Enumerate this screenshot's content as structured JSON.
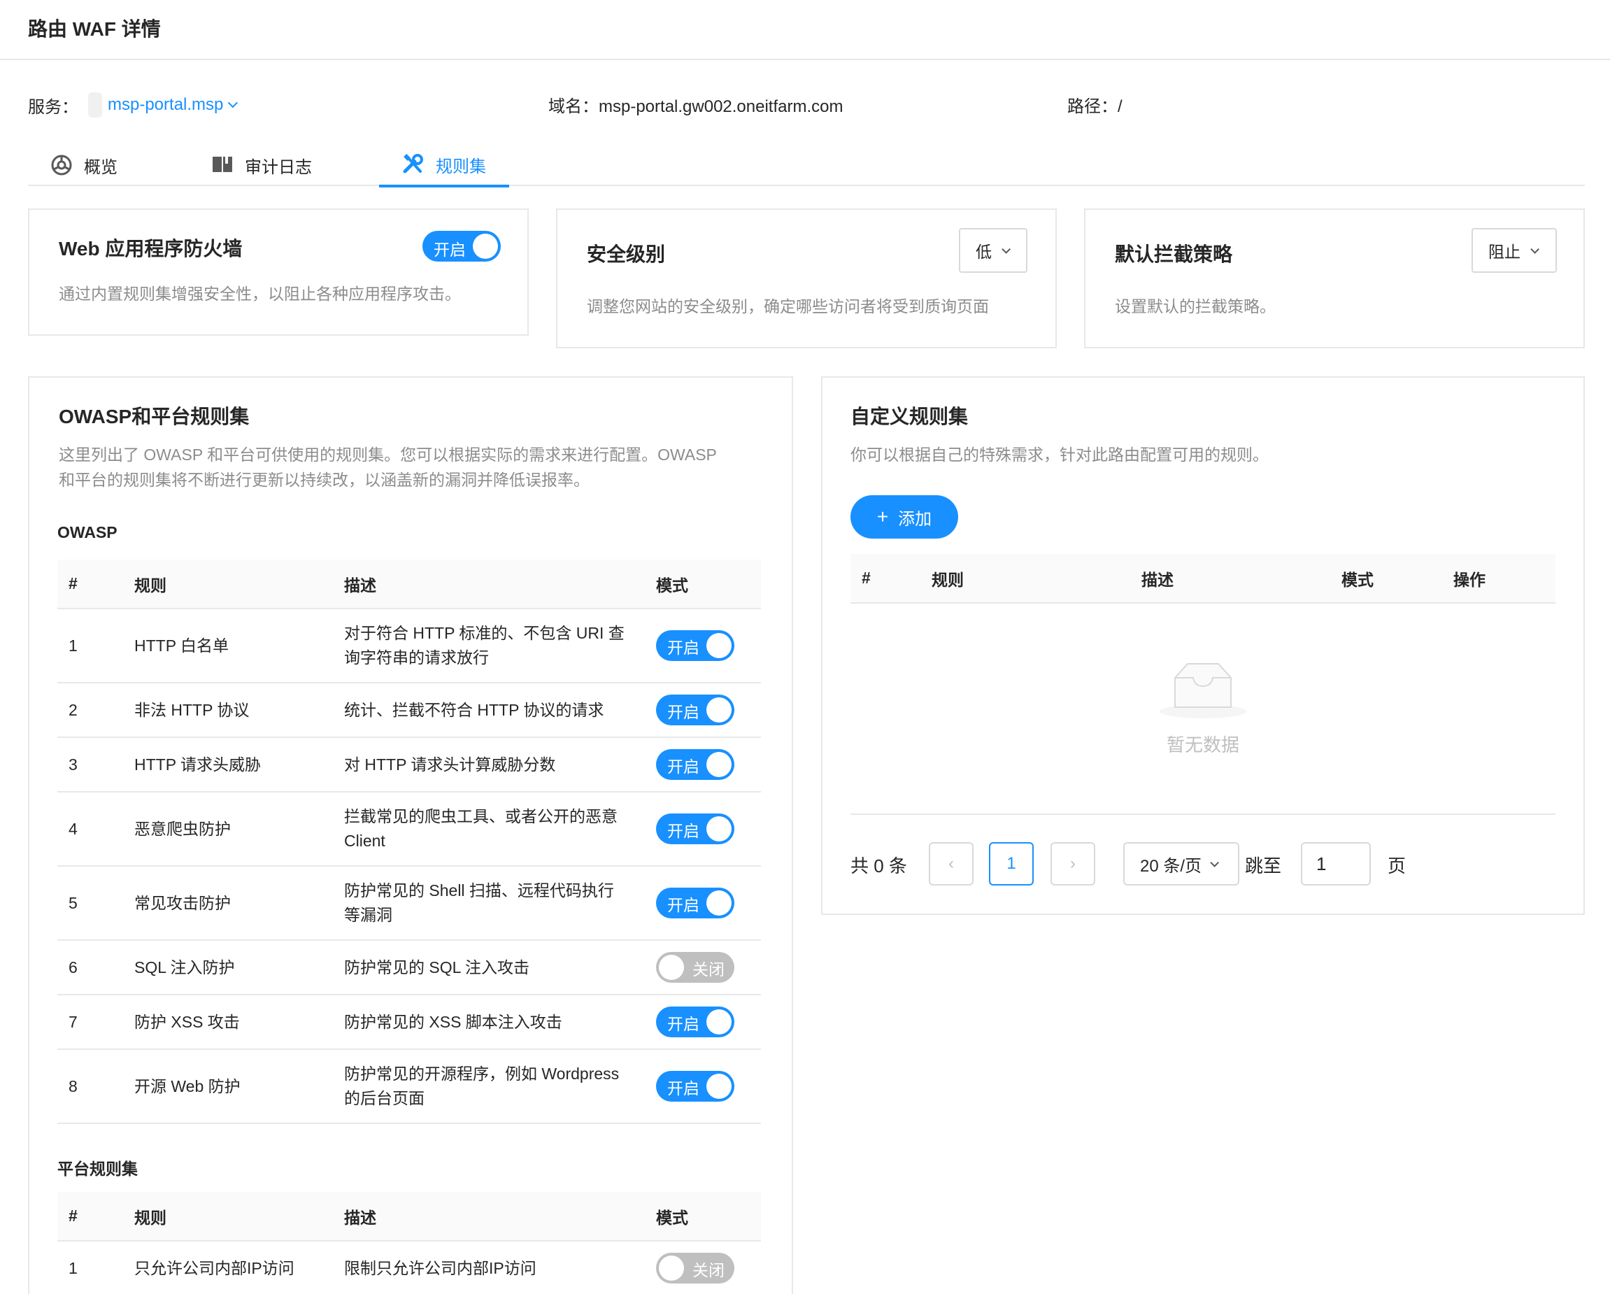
{
  "header": {
    "title": "路由 WAF 详情"
  },
  "info": {
    "service_label": "服务：",
    "service_value": "msp-portal.msp",
    "domain_label": "域名：",
    "domain_value": "msp-portal.gw002.oneitfarm.com",
    "path_label": "路径：",
    "path_value": "/"
  },
  "tabs": [
    {
      "label": "概览",
      "icon": "dashboard-icon",
      "active": false
    },
    {
      "label": "审计日志",
      "icon": "book-icon",
      "active": false
    },
    {
      "label": "规则集",
      "icon": "tools-icon",
      "active": true
    }
  ],
  "firewall": {
    "title": "Web 应用程序防火墙",
    "toggle_label": "开启",
    "enabled": true,
    "desc": "通过内置规则集增强安全性，以阻止各种应用程序攻击。"
  },
  "security_level": {
    "title": "安全级别",
    "value": "低",
    "desc": "调整您网站的安全级别，确定哪些访问者将受到质询页面"
  },
  "block_policy": {
    "title": "默认拦截策略",
    "value": "阻止",
    "desc": "设置默认的拦截策略。"
  },
  "owasp_card": {
    "title": "OWASP和平台规则集",
    "desc_line1": "这里列出了 OWASP 和平台可供使用的规则集。您可以根据实际的需求来进行配置。OWASP",
    "desc_line2": "和平台的规则集将不断进行更新以持续改，以涵盖新的漏洞并降低误报率。",
    "owasp_section": "OWASP",
    "platform_section": "平台规则集",
    "columns": [
      "#",
      "规则",
      "描述",
      "模式"
    ],
    "owasp_rows": [
      {
        "no": "1",
        "rule": "HTTP 白名单",
        "desc": "对于符合 HTTP 标准的、不包含 URI 查询字符串的请求放行",
        "mode": "开启",
        "on": true
      },
      {
        "no": "2",
        "rule": "非法 HTTP 协议",
        "desc": "统计、拦截不符合 HTTP 协议的请求",
        "mode": "开启",
        "on": true
      },
      {
        "no": "3",
        "rule": "HTTP 请求头威胁",
        "desc": "对 HTTP 请求头计算威胁分数",
        "mode": "开启",
        "on": true
      },
      {
        "no": "4",
        "rule": "恶意爬虫防护",
        "desc": "拦截常见的爬虫工具、或者公开的恶意 Client",
        "mode": "开启",
        "on": true
      },
      {
        "no": "5",
        "rule": "常见攻击防护",
        "desc": "防护常见的 Shell 扫描、远程代码执行等漏洞",
        "mode": "开启",
        "on": true
      },
      {
        "no": "6",
        "rule": "SQL 注入防护",
        "desc": "防护常见的 SQL 注入攻击",
        "mode": "关闭",
        "on": false
      },
      {
        "no": "7",
        "rule": "防护 XSS 攻击",
        "desc": "防护常见的 XSS 脚本注入攻击",
        "mode": "开启",
        "on": true
      },
      {
        "no": "8",
        "rule": "开源 Web 防护",
        "desc": "防护常见的开源程序，例如 Wordpress 的后台页面",
        "mode": "开启",
        "on": true
      }
    ],
    "platform_rows": [
      {
        "no": "1",
        "rule": "只允许公司内部IP访问",
        "desc": "限制只允许公司内部IP访问",
        "mode": "关闭",
        "on": false
      }
    ]
  },
  "custom_card": {
    "title": "自定义规则集",
    "desc": "你可以根据自己的特殊需求，针对此路由配置可用的规则。",
    "add_label": "添加",
    "columns": [
      "#",
      "规则",
      "描述",
      "模式",
      "操作"
    ],
    "empty_text": "暂无数据",
    "pagination": {
      "total": "共 0 条",
      "current_page": "1",
      "page_size": "20 条/页",
      "jump_label": "跳至",
      "jump_value": "1",
      "page_suffix": "页"
    }
  },
  "colors": {
    "primary": "#1890ff",
    "switch_off": "#bfbfbf",
    "border": "#e8e8e8"
  }
}
